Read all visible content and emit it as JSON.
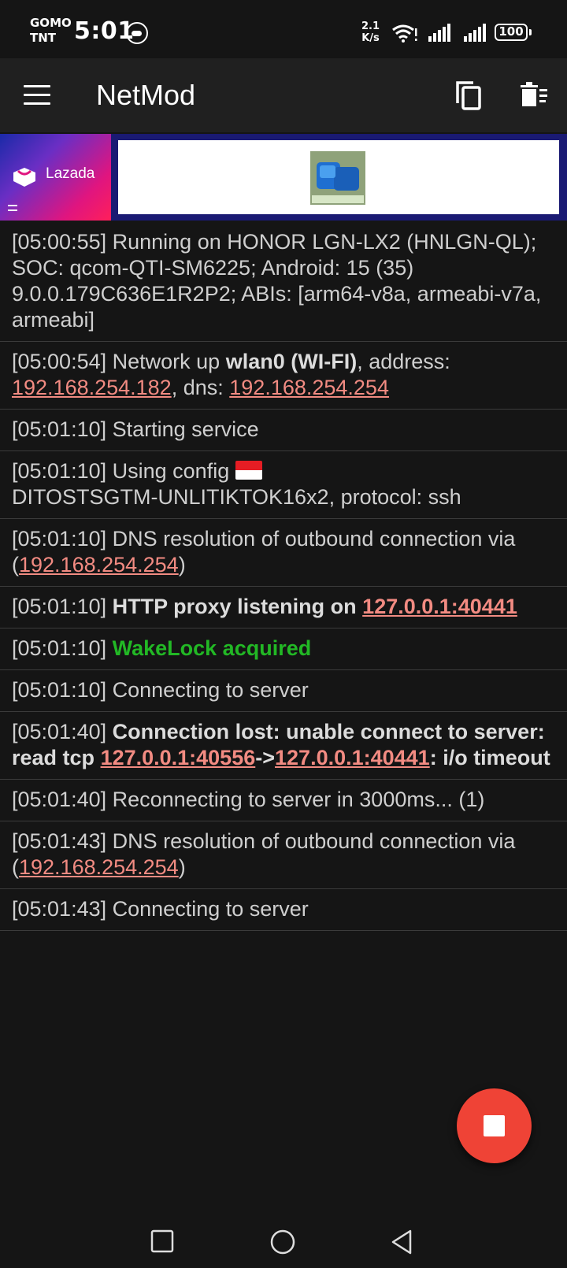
{
  "status_bar": {
    "carrier_line1": "GOMO",
    "carrier_line2": "TNT",
    "time": "5:01",
    "net_speed_value": "2.1",
    "net_speed_unit": "K/s",
    "battery": "100",
    "icons": [
      "cloud-sync-icon",
      "wifi-icon",
      "signal-icon",
      "signal-icon",
      "battery-icon"
    ]
  },
  "app_bar": {
    "title": "NetMod",
    "menu_icon": "menu-icon",
    "actions": [
      "copy-icon",
      "delete-icon"
    ]
  },
  "ad": {
    "brand": "Lazada"
  },
  "log": [
    {
      "time": "[05:00:55]",
      "text": "Running on HONOR LGN-LX2 (HNLGN-QL); SOC: qcom-QTI-SM6225; Android: 15 (35) 9.0.0.179C636E1R2P2; ABIs: [arm64-v8a, armeabi-v7a, armeabi]"
    },
    {
      "time": "[05:00:54]",
      "pre": "Network up",
      "iface": "wlan0 (WI-FI)",
      "mid": ", address:",
      "address": "192.168.254.182",
      "mid2": ", dns:",
      "dns": "192.168.254.254"
    },
    {
      "time": "[05:01:10]",
      "text": "Starting service"
    },
    {
      "time": "[05:01:10]",
      "pre": "Using config",
      "config": "DITOSTSGTM-UNLITIKTOK16x2, protocol: ssh"
    },
    {
      "time": "[05:01:10]",
      "pre": "DNS resolution of outbound connection via (",
      "dns": "192.168.254.254",
      "post": ")"
    },
    {
      "time": "[05:01:10]",
      "bold": "HTTP proxy listening on",
      "address": "127.0.0.1:40441"
    },
    {
      "time": "[05:01:10]",
      "green": "WakeLock acquired"
    },
    {
      "time": "[05:01:10]",
      "text": "Connecting to server"
    },
    {
      "time": "[05:01:40]",
      "bold1": "Connection lost: unable connect to server: read tcp",
      "src": "127.0.0.1:40556",
      "arrow": "->",
      "dst": "127.0.0.1:40441",
      "bold2": ": i/o timeout"
    },
    {
      "time": "[05:01:40]",
      "text": "Reconnecting to server in 3000ms... (1)"
    },
    {
      "time": "[05:01:43]",
      "pre": "DNS resolution of outbound connection via (",
      "dns": "192.168.254.254",
      "post": ")"
    },
    {
      "time": "[05:01:43]",
      "text": "Connecting to server"
    }
  ],
  "fab": {
    "icon": "stop-icon"
  },
  "nav_bar": {
    "icons": [
      "recents-icon",
      "home-icon",
      "back-icon"
    ]
  }
}
